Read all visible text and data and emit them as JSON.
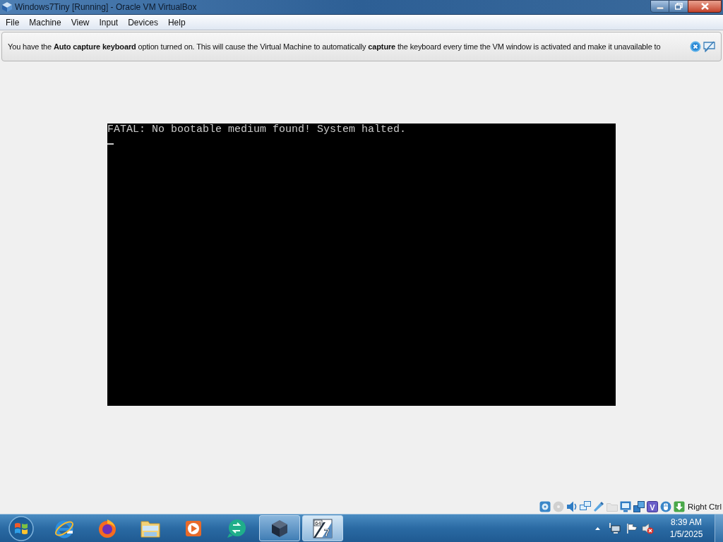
{
  "window": {
    "title": "Windows7Tiny [Running] - Oracle VM VirtualBox"
  },
  "menu_bar": {
    "items": [
      "File",
      "Machine",
      "View",
      "Input",
      "Devices",
      "Help"
    ]
  },
  "notification": {
    "text": "You have the **Auto capture keyboard** option turned on. This will cause the Virtual Machine to automatically **capture** the keyboard every time the VM window is activated and make it unavailable to"
  },
  "vm_screen": {
    "lines": [
      "FATAL: No bootable medium found! System halted."
    ]
  },
  "status_bar": {
    "indicators": [
      {
        "kind": "hard-disk",
        "disabled": false
      },
      {
        "kind": "optical",
        "disabled": true
      },
      {
        "kind": "audio",
        "disabled": false
      },
      {
        "kind": "network",
        "disabled": false
      },
      {
        "kind": "usb",
        "disabled": false
      },
      {
        "kind": "shared-folders",
        "disabled": true
      },
      {
        "kind": "display",
        "disabled": false
      },
      {
        "kind": "recording",
        "disabled": false
      },
      {
        "kind": "cpu",
        "disabled": false,
        "glyph": "V"
      },
      {
        "kind": "mouse",
        "disabled": false
      },
      {
        "kind": "keyboard",
        "disabled": false
      }
    ],
    "host_key": "Right Ctrl"
  },
  "taskbar": {
    "apps": [
      {
        "kind": "e-logo",
        "running": false,
        "selected": false
      },
      {
        "kind": "fox",
        "running": false,
        "selected": false
      },
      {
        "kind": "folder",
        "running": false,
        "selected": false
      },
      {
        "kind": "player",
        "running": false,
        "selected": false
      },
      {
        "kind": "chat",
        "running": false,
        "selected": false
      },
      {
        "kind": "cube",
        "running": true,
        "selected": false
      },
      {
        "kind": "vm",
        "running": true,
        "selected": true,
        "badge": "64",
        "numeral": "7"
      }
    ],
    "tray": {
      "muted": true
    },
    "clock": {
      "time": "8:39 AM",
      "date": "1/5/2025"
    }
  }
}
